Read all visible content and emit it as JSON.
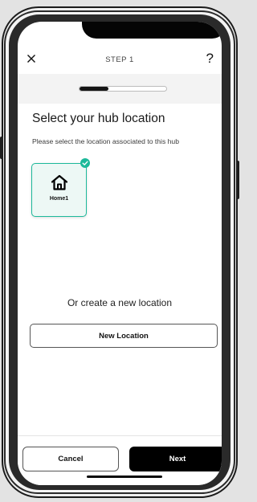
{
  "header": {
    "step_label": "STEP 1",
    "help_symbol": "?",
    "close_icon": "close-icon"
  },
  "progress": {
    "fraction": 0.33
  },
  "main": {
    "title": "Select your hub location",
    "subtitle": "Please select the location associated to this hub",
    "locations": [
      {
        "label": "Home1",
        "icon": "home-icon",
        "selected": true
      }
    ],
    "create_prompt": "Or create a new location",
    "new_location_label": "New Location"
  },
  "footer": {
    "cancel_label": "Cancel",
    "next_label": "Next"
  },
  "colors": {
    "accent": "#1db99a",
    "primary": "#000000",
    "card_background": "#edf8f5"
  }
}
